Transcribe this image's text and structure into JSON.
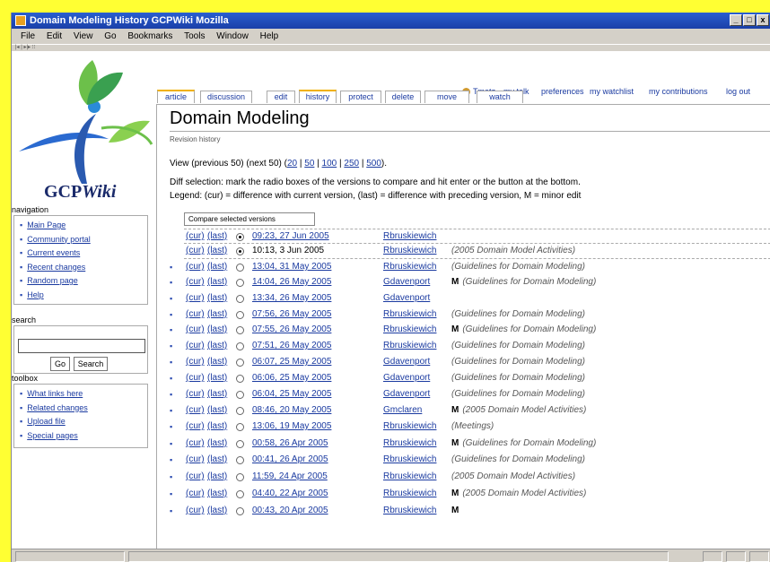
{
  "window": {
    "title": "Domain Modeling  History  GCPWiki  Mozilla",
    "controls": [
      "_",
      "□",
      "x"
    ]
  },
  "menu": [
    "File",
    "Edit",
    "View",
    "Go",
    "Bookmarks",
    "Tools",
    "Window",
    "Help"
  ],
  "toolbar_text": "|◂ | ▸|▸ ⁝⁝",
  "logo": {
    "text_main": "GCP",
    "text_italic": "Wiki"
  },
  "personal": {
    "user": "Tmetz",
    "talk": "my talk",
    "preferences": "preferences",
    "watchlist": "my watchlist",
    "contributions": "my contributions",
    "logout": "log out"
  },
  "tabs": [
    "article",
    "discussion",
    "edit",
    "history",
    "protect",
    "delete",
    "move",
    "watch"
  ],
  "navigation": {
    "title": "navigation",
    "items": [
      "Main Page",
      "Community portal",
      "Current events",
      "Recent changes",
      "Random page",
      "Help"
    ]
  },
  "search": {
    "title": "search",
    "go": "Go",
    "search": "Search"
  },
  "toolbox": {
    "title": "toolbox",
    "items": [
      "What links here",
      "Related changes",
      "Upload file",
      "Special pages"
    ]
  },
  "page": {
    "title": "Domain Modeling",
    "subtitle": "Revision history",
    "view_prefix": "View (previous 50) (next 50) (",
    "view_links": [
      "20",
      "50",
      "100",
      "250",
      "500"
    ],
    "view_suffix": ").",
    "diff_text": "Diff selection: mark the radio boxes of the versions to compare and hit enter or the button at the bottom.",
    "legend_text": "Legend: (cur) = difference with current version, (last) = difference with preceding version, M = minor edit",
    "compare_button": "Compare selected versions"
  },
  "revisions": [
    {
      "cur": "(cur)",
      "last": "(last)",
      "date": "09:23, 27 Jun 2005",
      "user": "Rbruskiewich",
      "minor": "",
      "comment": "",
      "bullet": false,
      "radio": "checked",
      "date_link": true
    },
    {
      "cur": "(cur)",
      "last": "(last)",
      "date": "10:13, 3 Jun 2005",
      "user": "Rbruskiewich",
      "minor": "",
      "comment": "(2005 Domain Model Activities)",
      "bullet": false,
      "radio": "checked",
      "date_link": false
    },
    {
      "cur": "(cur)",
      "last": "(last)",
      "date": "13:04, 31 May 2005",
      "user": "Rbruskiewich",
      "minor": "",
      "comment": "(Guidelines for Domain Modeling)",
      "bullet": true,
      "radio": "",
      "date_link": true
    },
    {
      "cur": "(cur)",
      "last": "(last)",
      "date": "14:04, 26 May 2005",
      "user": "Gdavenport",
      "minor": "M",
      "comment": "(Guidelines for Domain Modeling)",
      "bullet": true,
      "radio": "",
      "date_link": true
    },
    {
      "cur": "(cur)",
      "last": "(last)",
      "date": "13:34, 26 May 2005",
      "user": "Gdavenport",
      "minor": "",
      "comment": "",
      "bullet": true,
      "radio": "",
      "date_link": true
    },
    {
      "cur": "(cur)",
      "last": "(last)",
      "date": "07:56, 26 May 2005",
      "user": "Rbruskiewich",
      "minor": "",
      "comment": "(Guidelines for Domain Modeling)",
      "bullet": true,
      "radio": "",
      "date_link": true
    },
    {
      "cur": "(cur)",
      "last": "(last)",
      "date": "07:55, 26 May 2005",
      "user": "Rbruskiewich",
      "minor": "M",
      "comment": "(Guidelines for Domain Modeling)",
      "bullet": true,
      "radio": "",
      "date_link": true
    },
    {
      "cur": "(cur)",
      "last": "(last)",
      "date": "07:51, 26 May 2005",
      "user": "Rbruskiewich",
      "minor": "",
      "comment": "(Guidelines for Domain Modeling)",
      "bullet": true,
      "radio": "",
      "date_link": true
    },
    {
      "cur": "(cur)",
      "last": "(last)",
      "date": "06:07, 25 May 2005",
      "user": "Gdavenport",
      "minor": "",
      "comment": "(Guidelines for Domain Modeling)",
      "bullet": true,
      "radio": "",
      "date_link": true
    },
    {
      "cur": "(cur)",
      "last": "(last)",
      "date": "06:06, 25 May 2005",
      "user": "Gdavenport",
      "minor": "",
      "comment": "(Guidelines for Domain Modeling)",
      "bullet": true,
      "radio": "",
      "date_link": true
    },
    {
      "cur": "(cur)",
      "last": "(last)",
      "date": "06:04, 25 May 2005",
      "user": "Gdavenport",
      "minor": "",
      "comment": "(Guidelines for Domain Modeling)",
      "bullet": true,
      "radio": "",
      "date_link": true
    },
    {
      "cur": "(cur)",
      "last": "(last)",
      "date": "08:46, 20 May 2005",
      "user": "Gmclaren",
      "minor": "M",
      "comment": "(2005 Domain Model Activities)",
      "bullet": true,
      "radio": "",
      "date_link": true
    },
    {
      "cur": "(cur)",
      "last": "(last)",
      "date": "13:06, 19 May 2005",
      "user": "Rbruskiewich",
      "minor": "",
      "comment": "(Meetings)",
      "bullet": true,
      "radio": "",
      "date_link": true
    },
    {
      "cur": "(cur)",
      "last": "(last)",
      "date": "00:58, 26 Apr 2005",
      "user": "Rbruskiewich",
      "minor": "M",
      "comment": "(Guidelines for Domain Modeling)",
      "bullet": true,
      "radio": "",
      "date_link": true
    },
    {
      "cur": "(cur)",
      "last": "(last)",
      "date": "00:41, 26 Apr 2005",
      "user": "Rbruskiewich",
      "minor": "",
      "comment": "(Guidelines for Domain Modeling)",
      "bullet": true,
      "radio": "",
      "date_link": true
    },
    {
      "cur": "(cur)",
      "last": "(last)",
      "date": "11:59, 24 Apr 2005",
      "user": "Rbruskiewich",
      "minor": "",
      "comment": "(2005 Domain Model Activities)",
      "bullet": true,
      "radio": "",
      "date_link": true
    },
    {
      "cur": "(cur)",
      "last": "(last)",
      "date": "04:40, 22 Apr 2005",
      "user": "Rbruskiewich",
      "minor": "M",
      "comment": "(2005 Domain Model Activities)",
      "bullet": true,
      "radio": "",
      "date_link": true
    },
    {
      "cur": "(cur)",
      "last": "(last)",
      "date": "00:43, 20 Apr 2005",
      "user": "Rbruskiewich",
      "minor": "M",
      "comment": "",
      "bullet": true,
      "radio": "",
      "date_link": true
    }
  ],
  "colors": {
    "link": "#1a3aa0",
    "accent_tab": "#f0b000",
    "background": "#ffff33",
    "titlebar": "#2a5fd0"
  }
}
